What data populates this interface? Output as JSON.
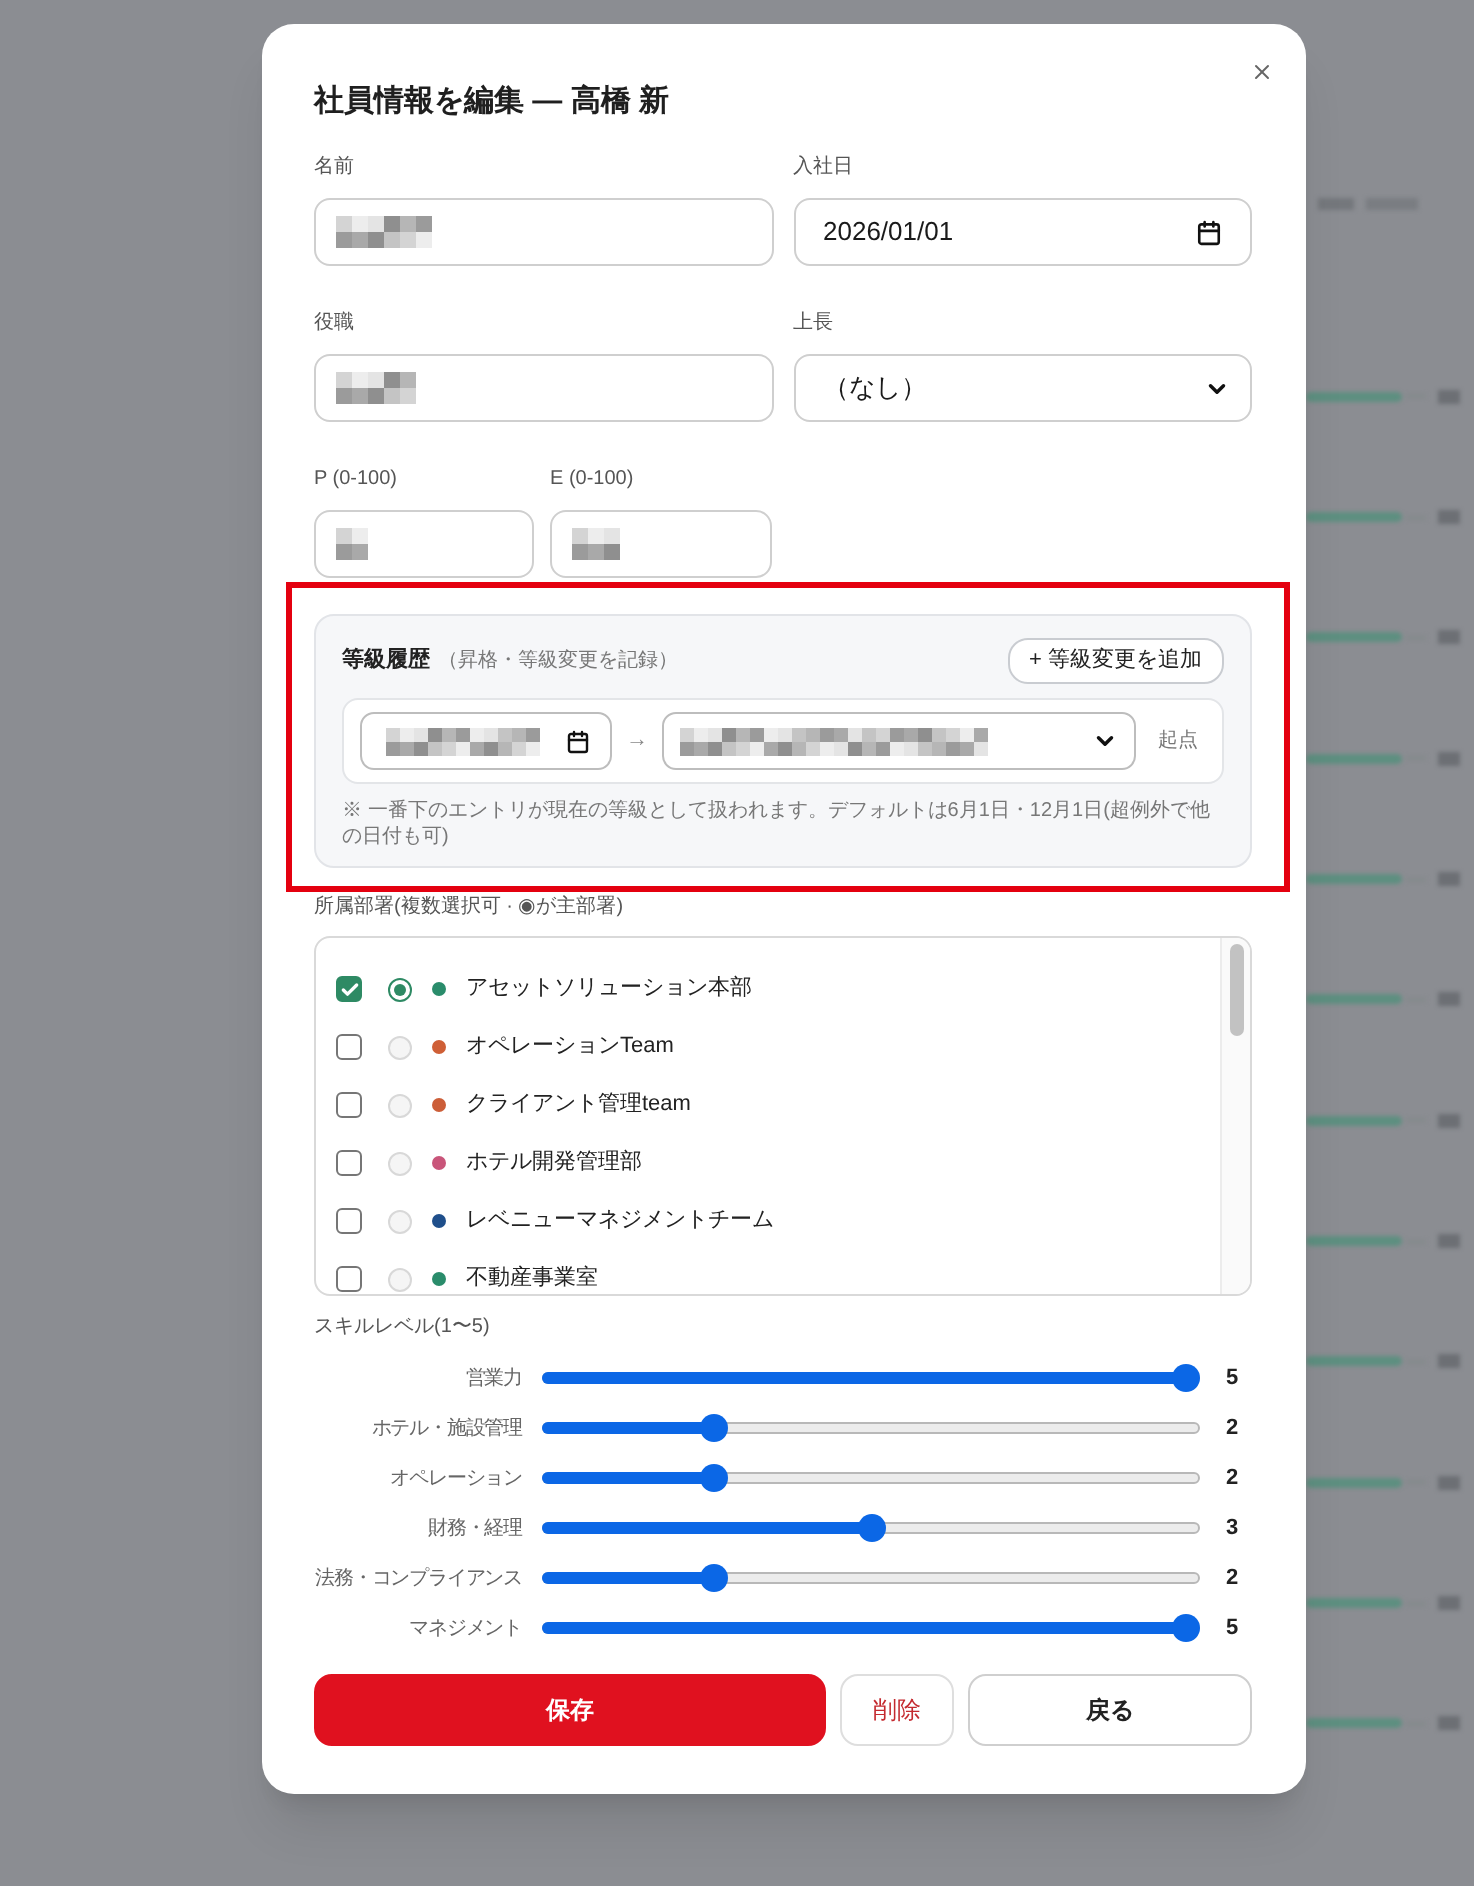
{
  "dialog": {
    "title": "社員情報を編集 — 高橋 新"
  },
  "fields": [
    {
      "label": "名前",
      "kind": "text",
      "value_pixelated": true
    },
    {
      "label": "入社日",
      "kind": "date",
      "value": "2026/01/01"
    },
    {
      "label": "役職",
      "kind": "text",
      "value_pixelated": true
    },
    {
      "label": "上長",
      "kind": "select",
      "value": "（なし）"
    }
  ],
  "scores": [
    {
      "label": "P (0-100)",
      "kind": "text",
      "value_pixelated": true
    },
    {
      "label": "E (0-100)",
      "kind": "text",
      "value_pixelated": true
    }
  ],
  "grade_history": {
    "title": "等級履歴",
    "subtitle": "（昇格・等級変更を記録）",
    "add_button": "+ 等級変更を追加",
    "entries": [
      {
        "date_pixelated": true,
        "arrow": "→",
        "grade_pixelated": true,
        "tag": "起点"
      }
    ],
    "note": "※ 一番下のエントリが現在の等級として扱われます。デフォルトは6月1日・12月1日(超例外で他の日付も可)"
  },
  "departments": {
    "label": "所属部署(複数選択可 · ◉が主部署)",
    "items": [
      {
        "name": "アセットソリューション本部",
        "checked": true,
        "selected": true,
        "color": "#2a8c6b"
      },
      {
        "name": "オペレーションTeam",
        "checked": false,
        "selected": false,
        "color": "#cf5f36"
      },
      {
        "name": "クライアント管理team",
        "checked": false,
        "selected": false,
        "color": "#cc5e38"
      },
      {
        "name": "ホテル開発管理部",
        "checked": false,
        "selected": false,
        "color": "#c9557a"
      },
      {
        "name": "レベニューマネジメントチーム",
        "checked": false,
        "selected": false,
        "color": "#1f4f8b"
      },
      {
        "name": "不動産事業室",
        "checked": false,
        "selected": false,
        "color": "#2a8c6b"
      }
    ]
  },
  "skills": {
    "label": "スキルレベル(1〜5)",
    "items": [
      {
        "label": "営業力",
        "value": "5",
        "level": 1
      },
      {
        "label": "ホテル・施設管理",
        "value": "2",
        "level": 0.25
      },
      {
        "label": "オペレーション",
        "value": "2",
        "level": 0.25
      },
      {
        "label": "財務・経理",
        "value": "3",
        "level": 0.5
      },
      {
        "label": "法務・コンプライアンス",
        "value": "2",
        "level": 0.25
      },
      {
        "label": "マネジメント",
        "value": "5",
        "level": 1
      }
    ]
  },
  "buttons": [
    {
      "label": "保存",
      "kind": "primary"
    },
    {
      "label": "削除",
      "kind": "danger"
    },
    {
      "label": "戻る",
      "kind": "secondary"
    }
  ]
}
